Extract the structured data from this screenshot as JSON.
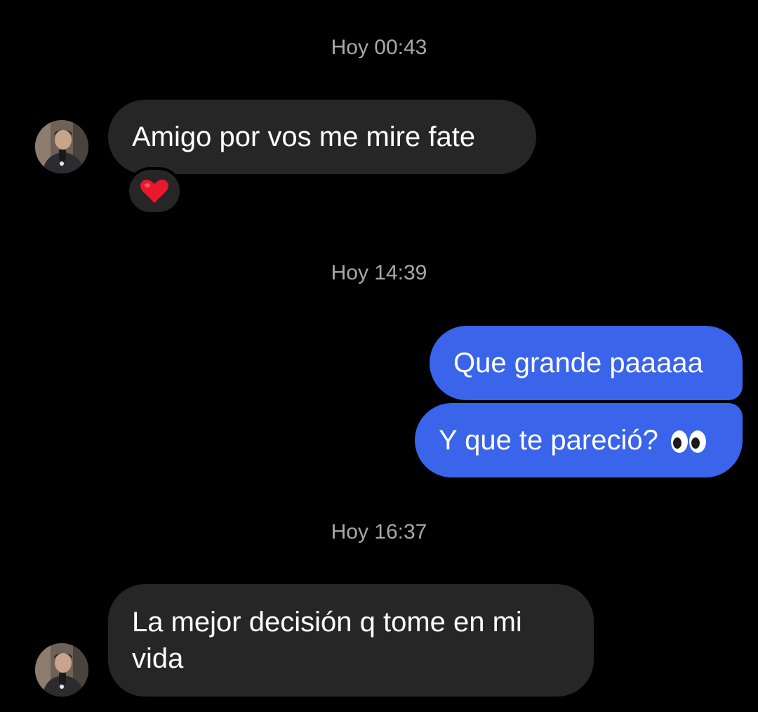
{
  "conversation": {
    "timestamps": [
      "Hoy 00:43",
      "Hoy 14:39",
      "Hoy 16:37"
    ],
    "messages": [
      {
        "sender": "contact",
        "text": "Amigo por vos me mire fate",
        "reaction": "heart-icon"
      },
      {
        "sender": "me",
        "text": "Que grande paaaaa"
      },
      {
        "sender": "me",
        "text": "Y que te pareció?",
        "emoji": "eyes-icon"
      },
      {
        "sender": "contact",
        "line1": "La mejor decisión q tome en mi",
        "line2": "vida"
      }
    ]
  },
  "colors": {
    "background": "#000000",
    "incoming_bubble": "#262626",
    "outgoing_bubble": "#3a64ea",
    "timestamp_text": "#a8a8a8",
    "reaction_heart": "#e8192c"
  }
}
